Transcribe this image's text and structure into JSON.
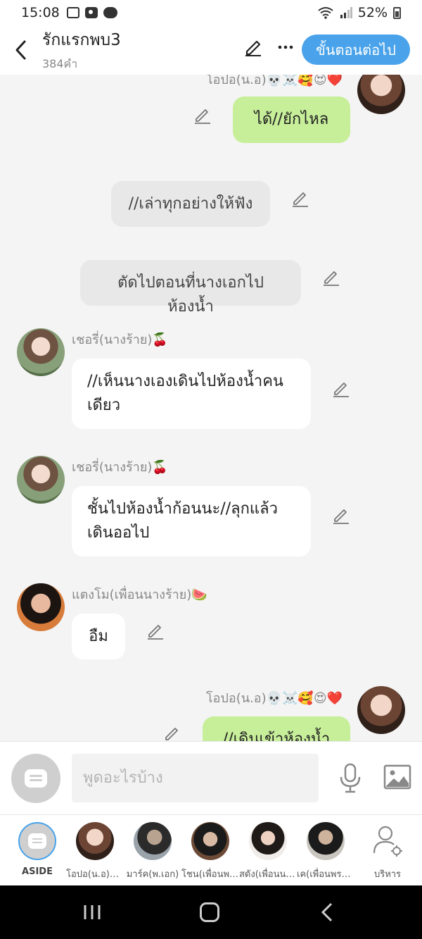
{
  "status_bar": {
    "time": "15:08",
    "battery": "52%"
  },
  "header": {
    "title": "รักแรกพบ3",
    "word_count": "384คำ",
    "next_button": "ขั้นตอนต่อไป"
  },
  "messages": {
    "m0_name": "โอปอ(น.อ)💀☠️🥰😍❤️",
    "m0_text": "ได้//ยักไหล",
    "m1_text": "//เล่าทุกอย่างให้ฟัง",
    "m2_text": "ตัดไปตอนที่นางเอกไปห้องน้ำ",
    "m3_name": "เชอรี่(นางร้าย)🍒",
    "m3_text": "//เห็นนางเองเดินไปห้องน้ำคนเดียว",
    "m4_name": "เชอรี่(นางร้าย)🍒",
    "m4_text": "ชั้นไปห้องน้ำก้อนนะ//ลุกแล้วเดินออไป",
    "m5_name": "แตงโม(เพื่อนนางร้าย)🍉",
    "m5_text": "อืม",
    "m6_name": "โอปอ(น.อ)💀☠️🥰😍❤️",
    "m6_text": "//เดินเข้าห้องน้ำ"
  },
  "input_bar": {
    "placeholder": "พูดอะไรบ้าง"
  },
  "characters": [
    {
      "label": "ASIDE"
    },
    {
      "label": "โอปอ(น.อ)💀☠️"
    },
    {
      "label": "มาร์ค(พ.เอก)"
    },
    {
      "label": "โชน(เพื่อนพระเอก)"
    },
    {
      "label": "สดัง(เพื่อนนางเอก)"
    },
    {
      "label": "เค(เพื่อนพระเอก)"
    },
    {
      "label": "บริหาร"
    }
  ],
  "icons": {
    "back": "chevron-left-icon",
    "edit": "pencil-icon",
    "more": "more-dots-icon",
    "mic": "microphone-icon",
    "image": "image-icon",
    "manage": "user-settings-icon"
  },
  "colors": {
    "accent": "#4aa3ea",
    "my_bubble": "#c7ef9a",
    "narration": "#e8e8e8"
  }
}
